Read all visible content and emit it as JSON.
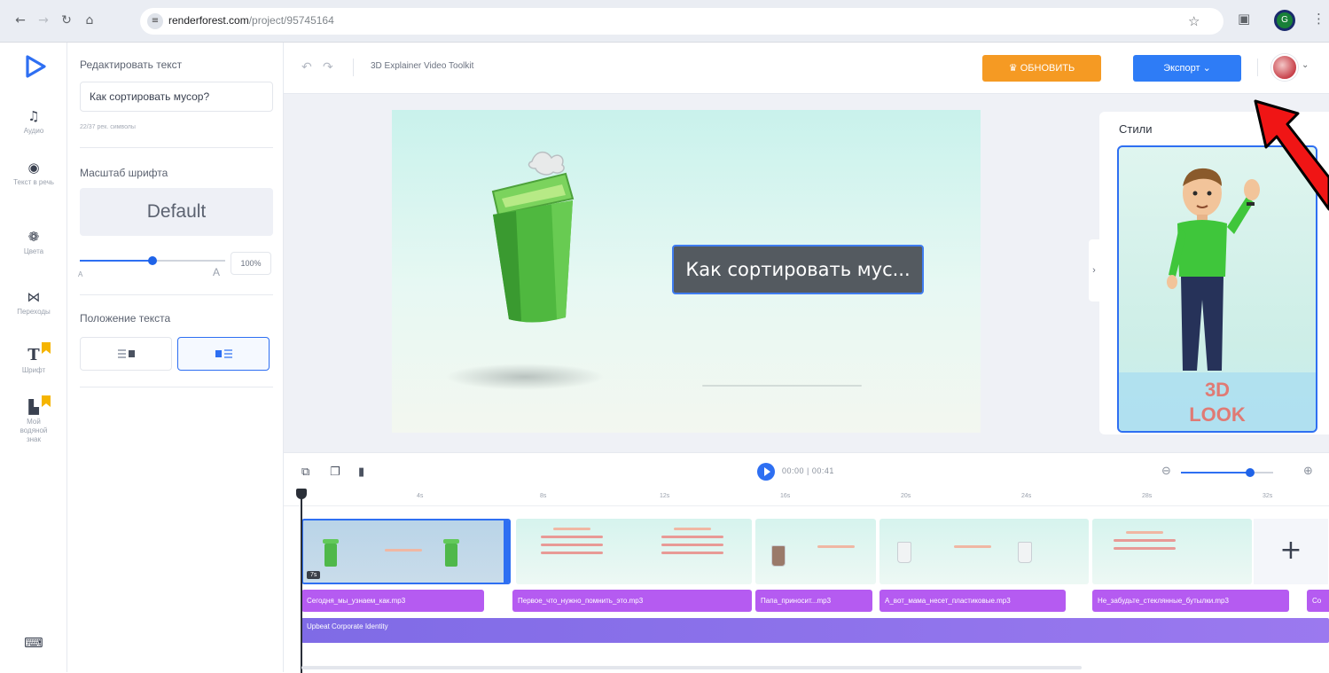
{
  "browser": {
    "url_host": "renderforest.com",
    "url_path": "/project/95745164",
    "back_icon": "arrow-left-icon",
    "forward_icon": "arrow-right-icon",
    "reload_icon": "reload-icon",
    "home_icon": "home-icon",
    "profile_initial": "G"
  },
  "rail": {
    "items": [
      {
        "label": "Аудио",
        "icon": "music-note-icon"
      },
      {
        "label": "Текст в речь",
        "icon": "text-to-speech-icon"
      },
      {
        "label": "Цвета",
        "icon": "palette-icon"
      },
      {
        "label": "Переходы",
        "icon": "transition-icon"
      },
      {
        "label": "Шрифт",
        "icon": "font-icon"
      },
      {
        "label": "Мой водяной знак",
        "icon": "watermark-icon"
      }
    ],
    "bottom_icon": "keyboard-icon",
    "badge_color": "#F5B400"
  },
  "panel": {
    "edit_text_heading": "Редактировать текст",
    "text_value": "Как сортировать мусор?",
    "char_count": "22/37 рек. символы",
    "font_scale_heading": "Масштаб шрифта",
    "font_name": "Default",
    "font_scale_percent": "100%",
    "font_scale_level": 0.5,
    "small_a": "A",
    "big_a": "A",
    "text_position_heading": "Положение текста",
    "selected_position": "right"
  },
  "toolbar": {
    "project_title": "3D Explainer Video Toolkit",
    "upgrade_label": "ОБНОВИТЬ",
    "export_label": "Экспорт",
    "upgrade_color": "#F59A23",
    "export_color": "#2E7CF6"
  },
  "stage": {
    "caption_text": "Как сортировать мус...",
    "styles_title": "Стили",
    "style_card_line1": "3D",
    "style_card_line2": "LOOK",
    "accent_color": "#2E6FF2"
  },
  "timeline": {
    "time_current": "00:00",
    "time_total": "00:41",
    "zoom_level": 0.75,
    "ruler": [
      "4s",
      "8s",
      "12s",
      "16s",
      "20s",
      "24s",
      "28s",
      "32s"
    ],
    "scene_duration": "7s",
    "audio_clips": [
      "Сегодня_мы_узнаем_как.mp3",
      "Первое_что_нужно_помнить_это.mp3",
      "Папа_приносит...mp3",
      "А_вот_мама_несет_пластиковые.mp3",
      "Не_забудьте_стеклянные_бутылки.mp3",
      "Со"
    ],
    "music_track": "Upbeat Corporate Identity",
    "add_scene_label": "+"
  }
}
